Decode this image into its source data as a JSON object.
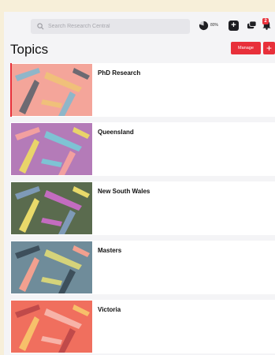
{
  "search": {
    "placeholder": "Search Research Central"
  },
  "toolbar": {
    "progress_label": "80%",
    "progress_value": 0.8,
    "notification_count": "2",
    "icons": [
      "search-icon",
      "progress-gauge-icon",
      "add-icon",
      "chat-icon",
      "bell-icon"
    ]
  },
  "page": {
    "title": "Topics",
    "manage_label": "Manage",
    "add_label": "+"
  },
  "topics": [
    {
      "title": "PhD Research",
      "colors": {
        "bg": "#f4a59a",
        "accent1": "#6d6a72",
        "accent2": "#f0c07a",
        "accent3": "#8fb6c9"
      }
    },
    {
      "title": "Queensland",
      "colors": {
        "bg": "#b47bb8",
        "accent1": "#e9d46a",
        "accent2": "#7ec3d4",
        "accent3": "#f2a0a0"
      }
    },
    {
      "title": "New South Wales",
      "colors": {
        "bg": "#5a6b4e",
        "accent1": "#e9d96a",
        "accent2": "#c36cc0",
        "accent3": "#7e9ab7"
      }
    },
    {
      "title": "Masters",
      "colors": {
        "bg": "#6f8c9a",
        "accent1": "#f2a08f",
        "accent2": "#d5d37a",
        "accent3": "#3d4f5b"
      }
    },
    {
      "title": "Victoria",
      "colors": {
        "bg": "#f06f5e",
        "accent1": "#f7c06a",
        "accent2": "#f7b3a8",
        "accent3": "#c04a4a"
      }
    }
  ],
  "colors": {
    "accent": "#e8303a",
    "background": "#f7efd9",
    "panel": "#f4f4f6"
  }
}
